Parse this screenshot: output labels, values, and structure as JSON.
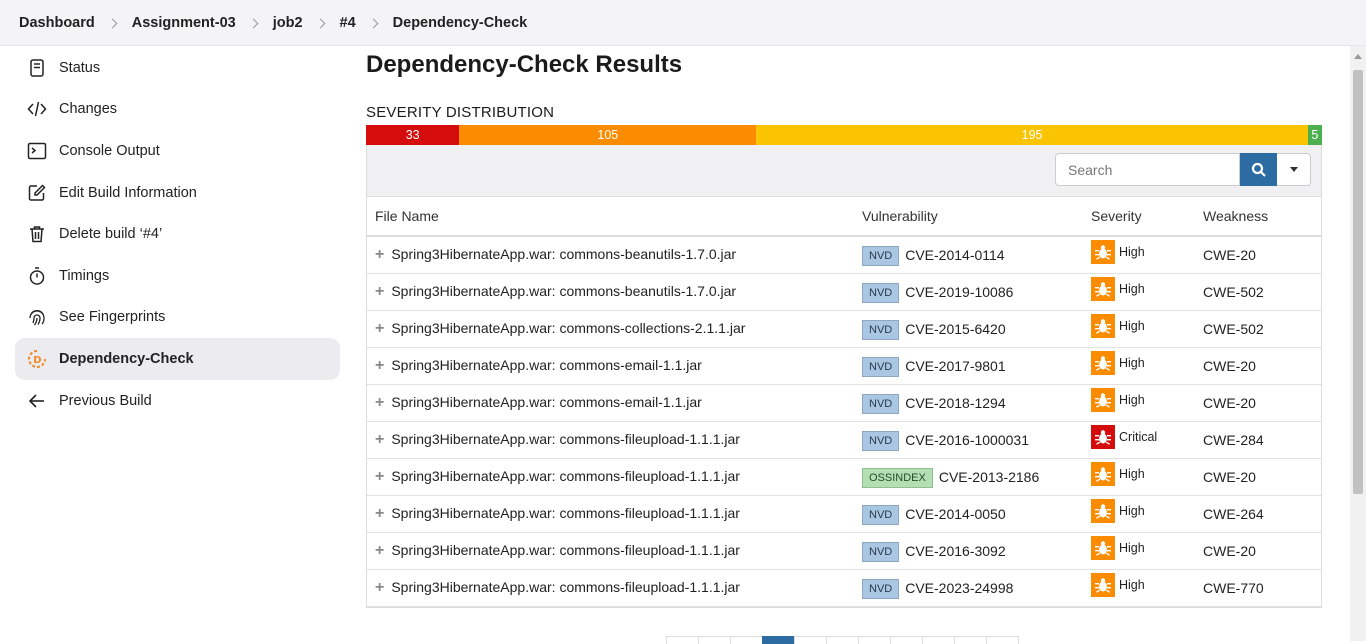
{
  "breadcrumb": [
    "Dashboard",
    "Assignment-03",
    "job2",
    "#4",
    "Dependency-Check"
  ],
  "sidebar": {
    "items": [
      {
        "label": "Status",
        "icon": "status-icon"
      },
      {
        "label": "Changes",
        "icon": "code-icon"
      },
      {
        "label": "Console Output",
        "icon": "terminal-icon"
      },
      {
        "label": "Edit Build Information",
        "icon": "edit-icon"
      },
      {
        "label": "Delete build ‘#4’",
        "icon": "trash-icon"
      },
      {
        "label": "Timings",
        "icon": "stopwatch-icon"
      },
      {
        "label": "See Fingerprints",
        "icon": "fingerprint-icon"
      },
      {
        "label": "Dependency-Check",
        "icon": "dependency-check-icon",
        "active": true
      },
      {
        "label": "Previous Build",
        "icon": "arrow-left-icon"
      }
    ]
  },
  "main": {
    "title": "Dependency-Check Results",
    "severity_title": "SEVERITY DISTRIBUTION",
    "severity": [
      {
        "label": "33",
        "value": 33,
        "color": "#d40c0c"
      },
      {
        "label": "105",
        "value": 105,
        "color": "#fb8c00"
      },
      {
        "label": "195",
        "value": 195,
        "color": "#fbc400"
      },
      {
        "label": "5",
        "value": 5,
        "color": "#4caf50"
      }
    ],
    "search_placeholder": "Search",
    "columns": [
      "File Name",
      "Vulnerability",
      "Severity",
      "Weakness"
    ],
    "rows": [
      {
        "file": "Spring3HibernateApp.war: commons-beanutils-1.7.0.jar",
        "source": "NVD",
        "cve": "CVE-2014-0114",
        "severity": "High",
        "weakness": "CWE-20"
      },
      {
        "file": "Spring3HibernateApp.war: commons-beanutils-1.7.0.jar",
        "source": "NVD",
        "cve": "CVE-2019-10086",
        "severity": "High",
        "weakness": "CWE-502"
      },
      {
        "file": "Spring3HibernateApp.war: commons-collections-2.1.1.jar",
        "source": "NVD",
        "cve": "CVE-2015-6420",
        "severity": "High",
        "weakness": "CWE-502"
      },
      {
        "file": "Spring3HibernateApp.war: commons-email-1.1.jar",
        "source": "NVD",
        "cve": "CVE-2017-9801",
        "severity": "High",
        "weakness": "CWE-20"
      },
      {
        "file": "Spring3HibernateApp.war: commons-email-1.1.jar",
        "source": "NVD",
        "cve": "CVE-2018-1294",
        "severity": "High",
        "weakness": "CWE-20"
      },
      {
        "file": "Spring3HibernateApp.war: commons-fileupload-1.1.1.jar",
        "source": "NVD",
        "cve": "CVE-2016-1000031",
        "severity": "Critical",
        "weakness": "CWE-284"
      },
      {
        "file": "Spring3HibernateApp.war: commons-fileupload-1.1.1.jar",
        "source": "OSSINDEX",
        "cve": "CVE-2013-2186",
        "severity": "High",
        "weakness": "CWE-20"
      },
      {
        "file": "Spring3HibernateApp.war: commons-fileupload-1.1.1.jar",
        "source": "NVD",
        "cve": "CVE-2014-0050",
        "severity": "High",
        "weakness": "CWE-264"
      },
      {
        "file": "Spring3HibernateApp.war: commons-fileupload-1.1.1.jar",
        "source": "NVD",
        "cve": "CVE-2016-3092",
        "severity": "High",
        "weakness": "CWE-20"
      },
      {
        "file": "Spring3HibernateApp.war: commons-fileupload-1.1.1.jar",
        "source": "NVD",
        "cve": "CVE-2023-24998",
        "severity": "High",
        "weakness": "CWE-770"
      }
    ],
    "severity_colors": {
      "High": "#fb8c00",
      "Critical": "#d40c0c"
    }
  }
}
